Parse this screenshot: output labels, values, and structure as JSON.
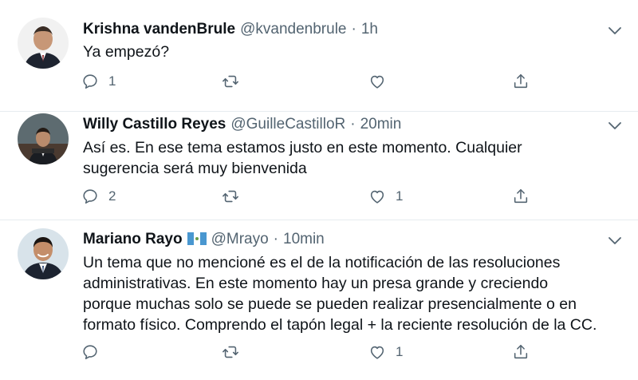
{
  "tweets": [
    {
      "name": "Krishna vandenBrule",
      "handle": "@kvandenbrule",
      "time": "1h",
      "text_lines": [
        "Ya empezó?"
      ],
      "reply_count": "1",
      "retweet_count": "",
      "like_count": "",
      "avatar": "person-in-suit"
    },
    {
      "name": "Willy Castillo Reyes",
      "handle": "@GuilleCastilloR",
      "time": "20min",
      "text_lines": [
        "Así es. En ese tema estamos justo en este momento.  Cualquier",
        "sugerencia será muy bienvenida"
      ],
      "reply_count": "2",
      "retweet_count": "",
      "like_count": "1",
      "avatar": "man-at-podium"
    },
    {
      "name": "Mariano Rayo",
      "handle": "@Mrayo",
      "time": "10min",
      "flag": "guatemala-flag",
      "text_lines": [
        "Un tema que no mencioné es el de la notificación de las resoluciones",
        "administrativas. En este momento hay un presa grande y creciendo",
        "porque muchas solo se puede se pueden realizar presencialmente o en",
        "formato físico. Comprendo el tapón legal + la reciente resolución de la CC."
      ],
      "reply_count": "",
      "retweet_count": "",
      "like_count": "1",
      "avatar": "smiling-man"
    }
  ],
  "separator": "·",
  "colors": {
    "muted": "#536471",
    "divider": "#e6ecf0",
    "text": "#0f1419"
  }
}
